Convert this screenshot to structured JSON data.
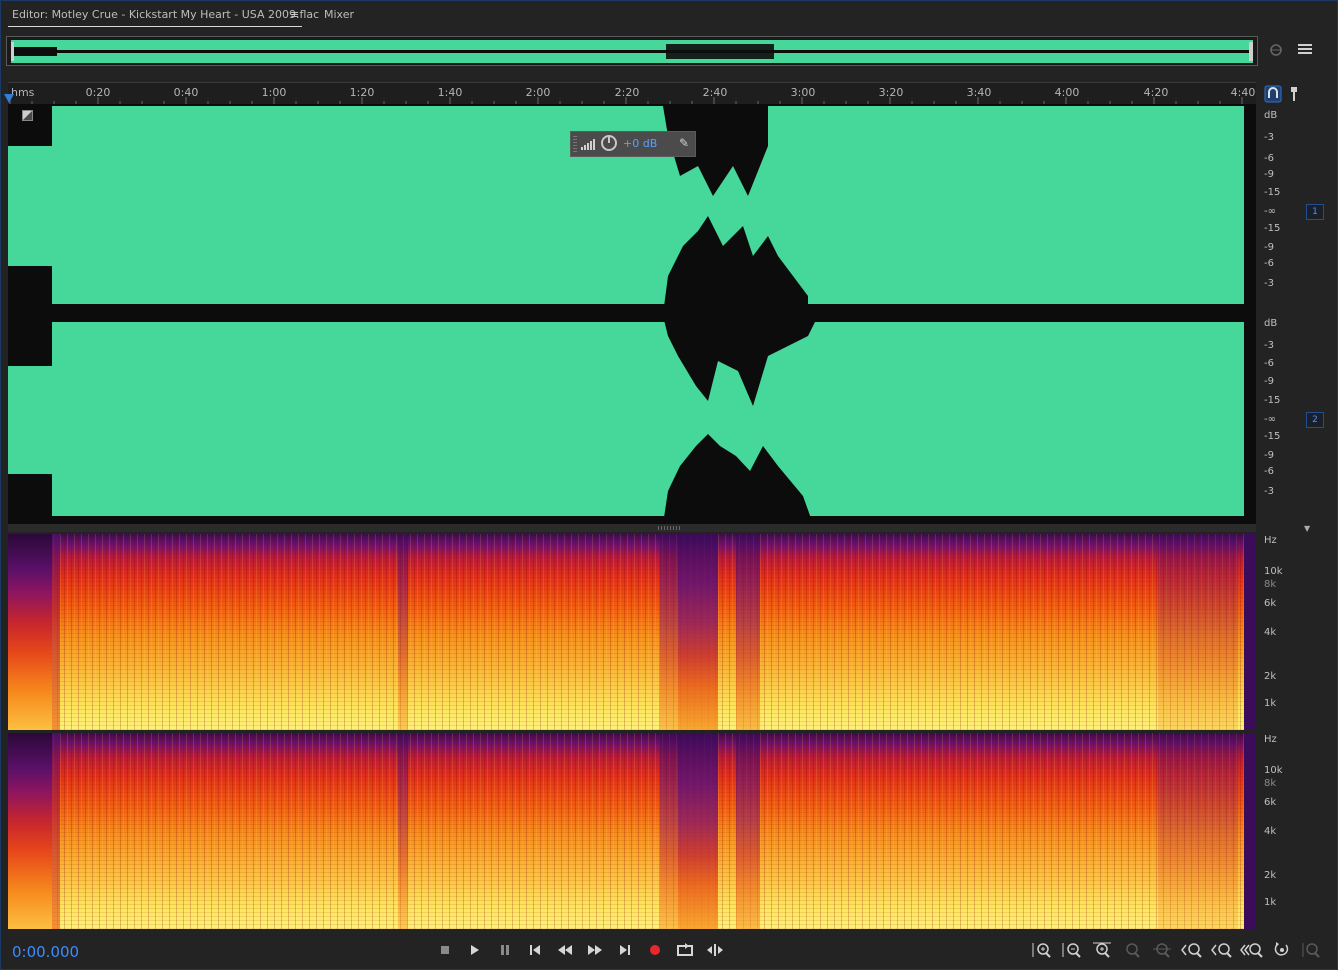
{
  "tabs": {
    "editor_label": "Editor: Motley Crue - Kickstart My Heart - USA 2009.flac",
    "editor_menu_glyph": "≡",
    "mixer_label": "Mixer"
  },
  "ruler": {
    "unit_label": "hms",
    "ticks": [
      "0:20",
      "0:40",
      "1:00",
      "1:20",
      "1:40",
      "2:00",
      "2:20",
      "2:40",
      "3:00",
      "3:20",
      "3:40",
      "4:00",
      "4:20",
      "4:40"
    ]
  },
  "hud": {
    "volume_value": "+0 dB"
  },
  "db_scale": {
    "unit": "dB",
    "labels": [
      "-3",
      "-6",
      "-9",
      "-15",
      "-∞",
      "-15",
      "-9",
      "-6",
      "-3"
    ]
  },
  "channels": [
    {
      "badge": "1"
    },
    {
      "badge": "2"
    }
  ],
  "freq_scale": {
    "unit": "Hz",
    "labels": [
      "10k",
      "8k",
      "6k",
      "4k",
      "2k",
      "1k"
    ]
  },
  "transport": {
    "timecode": "0:00.000",
    "buttons": [
      "stop-icon",
      "play-icon",
      "pause-icon",
      "go-to-start-icon",
      "rewind-icon",
      "fast-forward-icon",
      "go-to-end-icon",
      "record-icon",
      "loop-icon",
      "skip-selection-icon"
    ]
  },
  "zoom_tools": [
    "zoom-in-amplitude-icon",
    "zoom-out-amplitude-icon",
    "zoom-in-time-icon",
    "zoom-out-full-icon",
    "zoom-selection-icon",
    "zoom-in-left-icon",
    "zoom-in-right-icon",
    "zoom-out-all-icon",
    "reset-zoom-icon",
    "zoom-tracks-icon"
  ],
  "colors": {
    "waveform": "#46d89a",
    "timecode": "#3c8cff",
    "playhead": "#2f7fd9",
    "record": "#e8282e"
  }
}
